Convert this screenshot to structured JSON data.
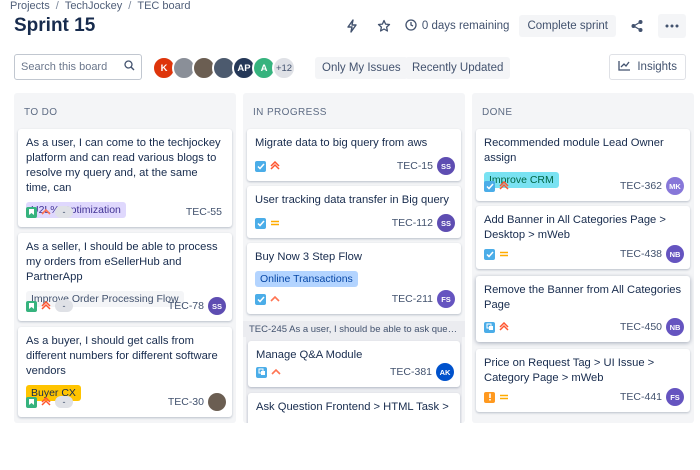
{
  "breadcrumb": [
    "Projects",
    "TechJockey",
    "TEC board"
  ],
  "title": "Sprint 15",
  "header": {
    "remaining": "0 days remaining",
    "complete": "Complete sprint"
  },
  "search": {
    "placeholder": "Search this board"
  },
  "avatars": [
    {
      "initials": "K",
      "color": "#de350b"
    },
    {
      "initials": "",
      "color": "#8a8f98"
    },
    {
      "initials": "",
      "color": "#6b5e52"
    },
    {
      "initials": "",
      "color": "#4c5a6e"
    },
    {
      "initials": "AP",
      "color": "#253858"
    },
    {
      "initials": "A",
      "color": "#36b37e"
    }
  ],
  "avatars_more": "+12",
  "filters": {
    "my_issues": "Only My Issues",
    "recent": "Recently Updated"
  },
  "insights": "Insights",
  "columns": {
    "todo": {
      "title": "TO DO",
      "cards": [
        {
          "title": "As a user, I can come to the techjockey platform and can read various blogs to resolve my query and, at the same time, can",
          "tag": "U2L% Optimization",
          "key": "TEC-55",
          "est": "-"
        },
        {
          "title": "As a seller, I should be able to process my orders from eSellerHub and PartnerApp",
          "tag": "Improve Order Processing Flow",
          "key": "TEC-78",
          "est": "-",
          "assignee": "SS"
        },
        {
          "title": "As a buyer, I should get calls from different numbers for different software vendors",
          "tag": "Buyer CX",
          "key": "TEC-30",
          "est": "-"
        }
      ]
    },
    "progress": {
      "title": "IN PROGRESS",
      "cards": [
        {
          "title": "Migrate data to big query from aws",
          "key": "TEC-15",
          "assignee": "SS"
        },
        {
          "title": "User tracking data transfer in Big query",
          "key": "TEC-112",
          "assignee": "SS"
        },
        {
          "title": "Buy Now 3 Step Flow",
          "tag": "Online Transactions",
          "key": "TEC-211",
          "assignee": "FS"
        }
      ],
      "subtask_header": "TEC-245  As a user, I should be able to ask questio...",
      "subcards": [
        {
          "title": "Manage Q&A Module",
          "key": "TEC-381",
          "assignee": "AK"
        },
        {
          "title": "Ask Question Frontend > HTML Task >"
        }
      ]
    },
    "done": {
      "title": "DONE",
      "cards": [
        {
          "title": "Recommended module Lead Owner assign",
          "tag": "Improve CRM",
          "key": "TEC-362",
          "assignee": "MK"
        },
        {
          "title": "Add Banner in All Categories Page > Desktop > mWeb",
          "key": "TEC-438",
          "assignee": "NB"
        },
        {
          "title": "Remove the Banner from All Categories Page",
          "key": "TEC-450",
          "assignee": "NB"
        },
        {
          "title": "Price on Request Tag > UI Issue > Category Page > mWeb",
          "key": "TEC-441",
          "assignee": "FS"
        }
      ]
    }
  },
  "colors": {
    "story": "#36b37e",
    "task": "#4bade8",
    "bug": "#ff991f",
    "assignee_ss": "#5e4db2",
    "assignee_fs": "#6554c0",
    "assignee_ak": "#0052cc",
    "assignee_mk": "#8777d9",
    "assignee_nb": "#6554c0",
    "tag_purple": "#dfd8fd",
    "tag_gray": "#f4f5f7",
    "tag_yellow": "#ffc400",
    "tag_blue": "#b3d4ff",
    "tag_teal": "#79e2f2"
  }
}
